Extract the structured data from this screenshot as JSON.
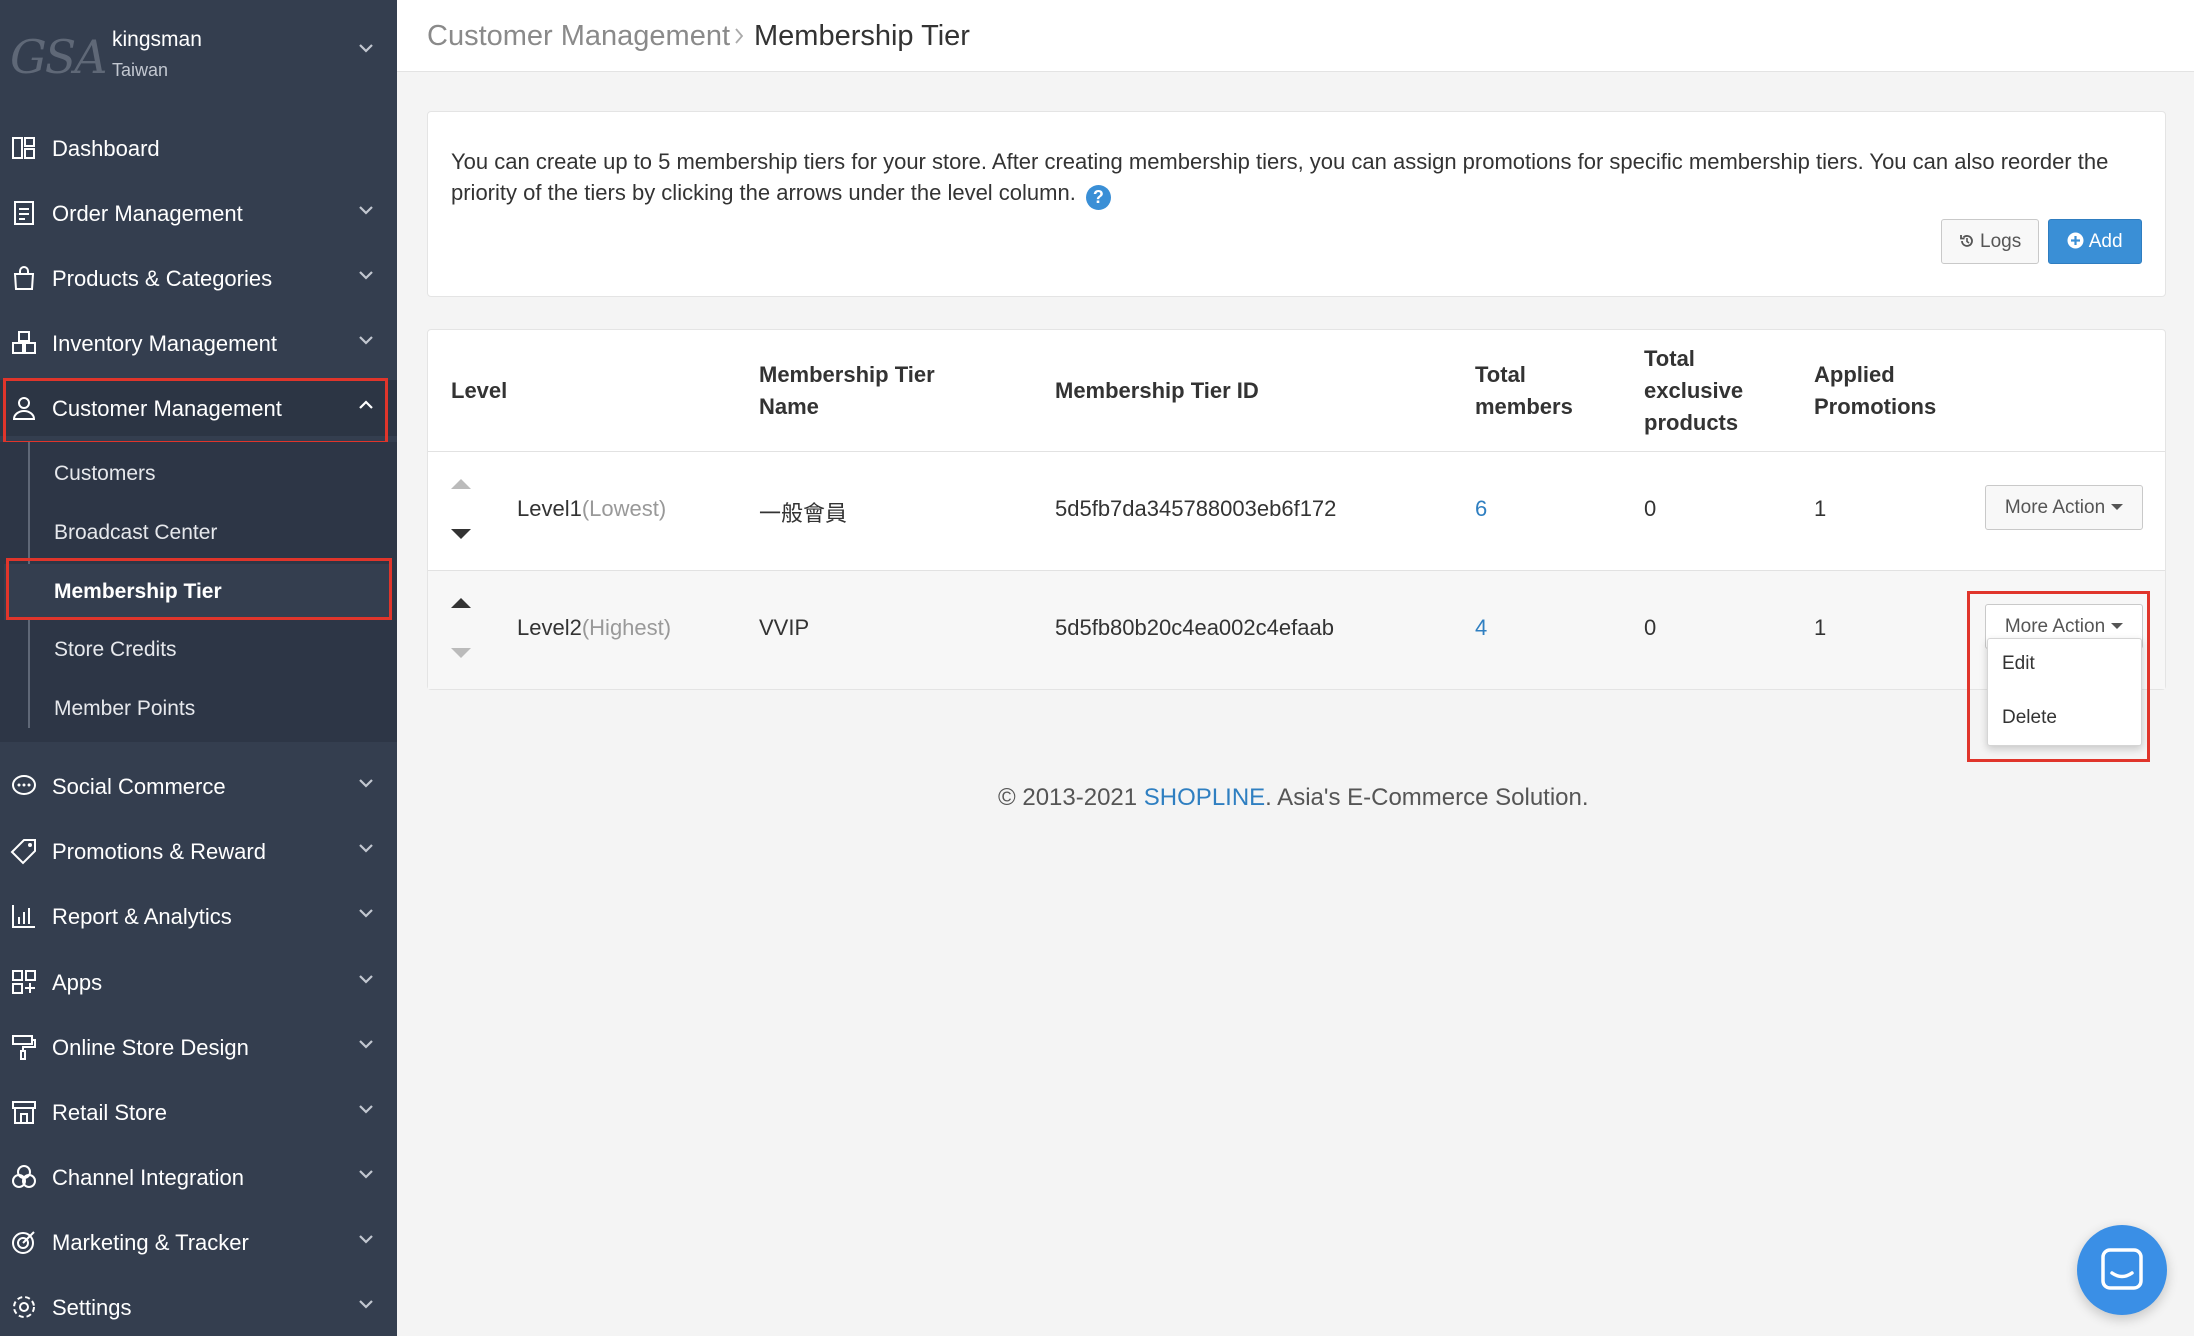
{
  "store": {
    "logo_text": "GSA",
    "name": "kingsman",
    "region": "Taiwan"
  },
  "sidebar": {
    "items": [
      {
        "label": "Dashboard",
        "icon": "dashboard-icon"
      },
      {
        "label": "Order Management",
        "icon": "receipt-icon"
      },
      {
        "label": "Products & Categories",
        "icon": "shopping-bag-icon"
      },
      {
        "label": "Inventory Management",
        "icon": "boxes-icon"
      },
      {
        "label": "Customer Management",
        "icon": "user-icon"
      },
      {
        "label": "Social Commerce",
        "icon": "chat-icon"
      },
      {
        "label": "Promotions & Reward",
        "icon": "tag-icon"
      },
      {
        "label": "Report & Analytics",
        "icon": "bar-chart-icon"
      },
      {
        "label": "Apps",
        "icon": "apps-grid-icon"
      },
      {
        "label": "Online Store Design",
        "icon": "paint-roller-icon"
      },
      {
        "label": "Retail Store",
        "icon": "store-icon"
      },
      {
        "label": "Channel Integration",
        "icon": "circles-icon"
      },
      {
        "label": "Marketing & Tracker",
        "icon": "target-icon"
      },
      {
        "label": "Settings",
        "icon": "gear-icon"
      }
    ],
    "sub_items": [
      {
        "label": "Customers"
      },
      {
        "label": "Broadcast Center"
      },
      {
        "label": "Membership Tier"
      },
      {
        "label": "Store Credits"
      },
      {
        "label": "Member Points"
      }
    ]
  },
  "breadcrumb": {
    "parent": "Customer Management",
    "current": "Membership Tier"
  },
  "info": {
    "text": "You can create up to 5 membership tiers for your store. After creating membership tiers, you can assign promotions for specific membership tiers. You can also reorder the priority of the tiers by clicking the arrows under the level column.",
    "help_glyph": "?",
    "logs_label": "Logs",
    "add_label": "Add"
  },
  "table": {
    "headers": {
      "level": "Level",
      "name_line1": "Membership Tier",
      "name_line2": "Name",
      "id": "Membership Tier ID",
      "members_line1": "Total",
      "members_line2": "members",
      "exclusive_line1": "Total",
      "exclusive_line2": "exclusive",
      "exclusive_line3": "products",
      "promos_line1": "Applied",
      "promos_line2": "Promotions"
    },
    "rows": [
      {
        "level": "Level1",
        "level_note": "(Lowest)",
        "name": "一般會員",
        "id": "5d5fb7da345788003eb6f172",
        "members": "6",
        "exclusive": "0",
        "promotions": "1",
        "action": "More Action"
      },
      {
        "level": "Level2",
        "level_note": "(Highest)",
        "name": "VVIP",
        "id": "5d5fb80b20c4ea002c4efaab",
        "members": "4",
        "exclusive": "0",
        "promotions": "1",
        "action": "More Action"
      }
    ]
  },
  "dropdown": {
    "edit": "Edit",
    "delete": "Delete"
  },
  "footer": {
    "prefix": "© 2013-2021 ",
    "brand": "SHOPLINE",
    "suffix": ". Asia's E-Commerce Solution."
  },
  "colors": {
    "sidebar": "#343e4f",
    "accent": "#3a8fd6",
    "highlight": "#e0352b"
  }
}
